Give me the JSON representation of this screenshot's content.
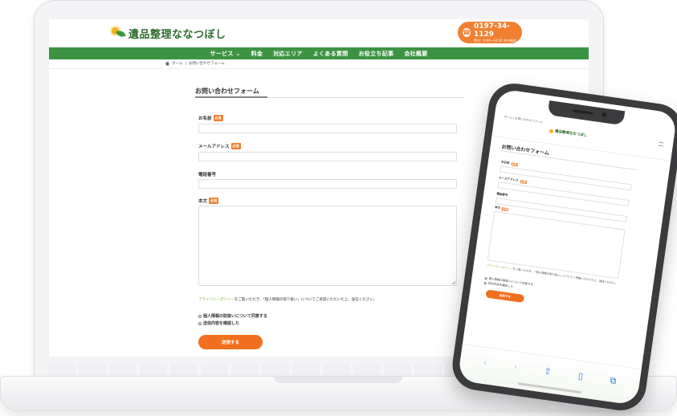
{
  "site": {
    "logo_text": "遺品整理ななつぼし",
    "phone_number": "0197-34-1129",
    "phone_hours": "受付：9:00~24:00 年中無休",
    "nav": [
      "サービス ⌄",
      "料金",
      "対応エリア",
      "よくある質問",
      "お役立ち記事",
      "会社概要"
    ],
    "breadcrumb": [
      "ホーム",
      "|",
      "お問い合わせフォーム"
    ]
  },
  "form": {
    "title": "お問い合わせフォーム",
    "required_badge": "必須",
    "fields": {
      "name_label": "お名前",
      "email_label": "メールアドレス",
      "phone_label": "電話番号",
      "body_label": "本文"
    },
    "privacy_link": "プライバシーポリシー",
    "privacy_text": "をご覧いただき、「個人情報の取り扱い」についてご承諾いただいた上、送信ください。",
    "consent_1": "個人情報の取扱いについて同意する",
    "consent_2": "送信内容を確認した",
    "submit_label": "送信する"
  },
  "mobile": {
    "breadcrumb": "ホーム | お問い合わせフォーム",
    "logo_text": "遺品整理ななつぼし",
    "title": "お問い合わせフォーム",
    "privacy_text": "をご覧いただき、「個人情報の取り扱い」についてご承諾いただいた上、送信ください。",
    "submit_label": "送信する",
    "toolbar_icons": [
      "back-icon",
      "forward-icon",
      "share-icon",
      "bookmarks-icon",
      "tabs-icon"
    ],
    "toolbar_glyphs": [
      "‹",
      "›",
      "⇧",
      "▯",
      "⧉"
    ]
  },
  "colors": {
    "brand_green": "#3d9344",
    "accent_orange": "#f07020",
    "link_green": "#7ab330"
  }
}
